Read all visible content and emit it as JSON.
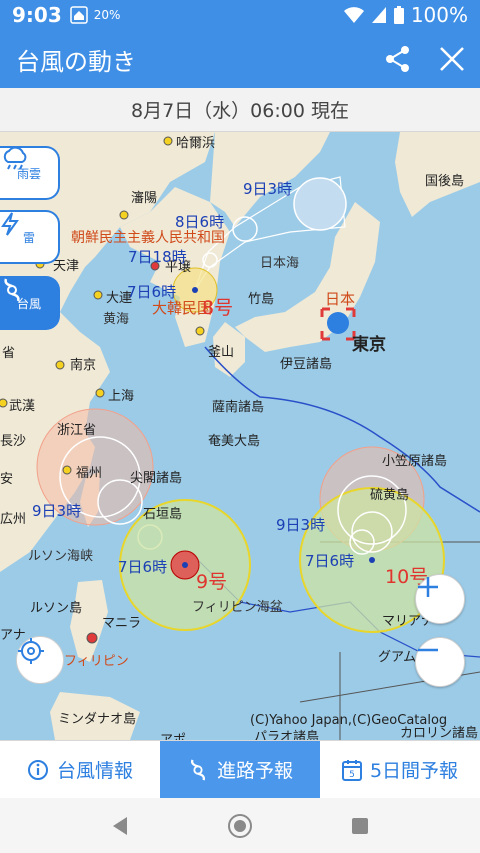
{
  "status": {
    "time": "9:03",
    "battery": "100%",
    "badge": "20%"
  },
  "appbar": {
    "title": "台風の動き"
  },
  "datebar": {
    "text": "8月7日（水）06:00 現在"
  },
  "sidebar": {
    "items": [
      {
        "label": "雨雲",
        "icon": "rain-cloud-icon"
      },
      {
        "label": "雷",
        "icon": "lightning-icon"
      },
      {
        "label": "台風",
        "icon": "typhoon-icon"
      }
    ]
  },
  "map": {
    "places": {
      "harbin": "哈爾浜",
      "shenyang": "瀋陽",
      "dalian": "大連",
      "tianjin": "天津",
      "pyongyang": "平壌",
      "nk": "朝鮮民主主義人民共和国",
      "sk": "大韓民国",
      "japan": "日本",
      "tokyo": "東京",
      "japansea": "日本海",
      "takeshima": "竹島",
      "busan": "釜山",
      "izu": "伊豆諸島",
      "yellowsea": "黄海",
      "nanjing": "南京",
      "shanghai": "上海",
      "wuhan": "武漢",
      "changsha": "長沙",
      "zhejiang": "浙江省",
      "fuzhou": "福州",
      "guangzhou": "広州",
      "senkaku": "尖閣諸島",
      "ishigaki": "石垣島",
      "satsunan": "薩南諸島",
      "amami": "奄美大島",
      "ogasawara": "小笠原諸島",
      "iwoto": "硫黄島",
      "luzonstrait": "ルソン海峡",
      "luzon": "ルソン島",
      "manila": "マニラ",
      "philippines": "フィリピン",
      "philsea": "フィリピン海盆",
      "mariana": "マリアナ",
      "guam": "グアム",
      "mindanao": "ミンダナオ島",
      "palau": "パラオ諸島",
      "caroline": "カロリン諸島",
      "kokoto": "国後島",
      "ana": "アナ",
      "an": "安",
      "sho": "省",
      "apo": "アポ"
    },
    "typhoon8": {
      "name": "8号",
      "labels": [
        "9日3時",
        "8日6時",
        "7日18時",
        "7日6時"
      ]
    },
    "typhoon9": {
      "name": "9号",
      "labels": [
        "9日3時",
        "7日6時"
      ]
    },
    "typhoon10": {
      "name": "10号",
      "labels": [
        "9日3時",
        "7日6時"
      ]
    },
    "copyright": "(C)Yahoo Japan,(C)GeoCatalog"
  },
  "tabs": [
    {
      "label": "台風情報",
      "icon": "info-icon"
    },
    {
      "label": "進路予報",
      "icon": "typhoon-icon"
    },
    {
      "label": "5日間予報",
      "icon": "calendar-icon"
    }
  ],
  "calendar_number": "5"
}
